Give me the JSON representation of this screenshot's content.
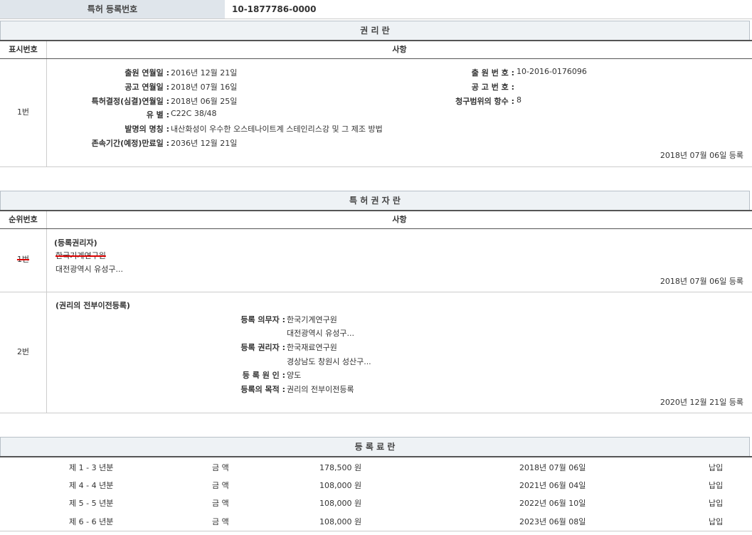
{
  "header": {
    "label": "특허 등록번호",
    "value": "10-1877786-0000"
  },
  "rights_section": {
    "title": "권 리 란",
    "col_num": "표시번호",
    "col_item": "사항",
    "row": {
      "num": "1번",
      "left_labels": [
        "출원 연월일 :",
        "공고 연월일 :",
        "특허결정(심결)연월일 :",
        "유 별 :",
        "발명의 명칭 :",
        "존속기간(예정)만료일 :"
      ],
      "left_values": [
        "2016년 12월 21일",
        "2018년 07월 16일",
        "2018년 06월 25일",
        "C22C 38/48",
        "내산화성이 우수한 오스테나이트계 스테인리스강 및 그 제조 방법",
        "2036년 12월 21일"
      ],
      "right_labels": [
        "출 원 번 호 :",
        "공 고 번 호 :",
        "청구범위의 항수 :"
      ],
      "right_values": [
        "10-2016-0176096",
        "",
        "8"
      ],
      "registered": "2018년 07월 06일 등록"
    }
  },
  "holder_section": {
    "title": "특 허 권 자 란",
    "col_num": "순위번호",
    "col_item": "사항",
    "row1": {
      "num": "1번",
      "heading": "(등록권리자)",
      "name": "한국기계연구원",
      "address": "대전광역시 유성구...",
      "registered": "2018년 07월 06일 등록"
    },
    "row2": {
      "num": "2번",
      "heading": "(권리의 전부이전등록)",
      "labels": [
        "등록 의무자 :",
        "",
        "등록 권리자 :",
        "",
        "등 록 원 인 :",
        "등록의 목적 :"
      ],
      "values": [
        "한국기계연구원",
        "대전광역시 유성구...",
        "한국재료연구원",
        "경상남도 창원시 성산구...",
        "양도",
        "권리의 전부이전등록"
      ],
      "registered": "2020년 12월 21일 등록"
    }
  },
  "fee_section": {
    "title": "등 록 료 란",
    "rows": [
      {
        "period": "제 1 - 3 년분",
        "label": "금 액",
        "amount": "178,500 원",
        "date": "2018년 07월 06일",
        "status": "납입"
      },
      {
        "period": "제 4 - 4 년분",
        "label": "금 액",
        "amount": "108,000 원",
        "date": "2021년 06월 04일",
        "status": "납입"
      },
      {
        "period": "제 5 - 5 년분",
        "label": "금 액",
        "amount": "108,000 원",
        "date": "2022년 06월 10일",
        "status": "납입"
      },
      {
        "period": "제 6 - 6 년분",
        "label": "금 액",
        "amount": "108,000 원",
        "date": "2023년 06월 08일",
        "status": "납입"
      }
    ]
  }
}
